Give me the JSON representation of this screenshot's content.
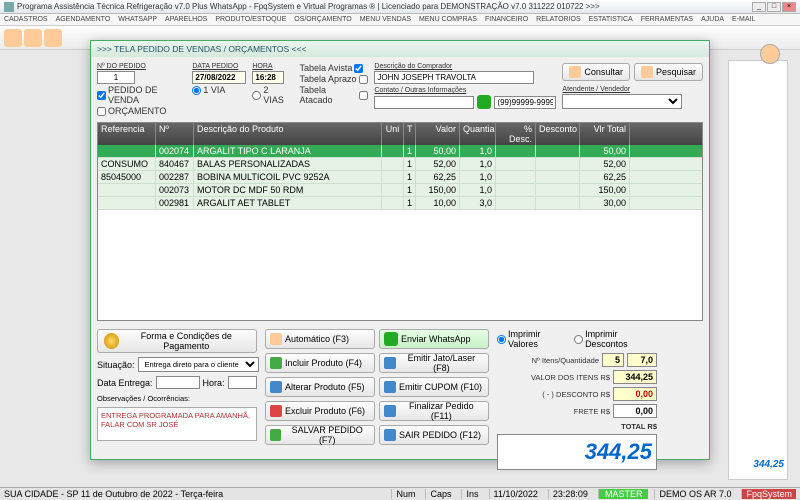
{
  "window": {
    "title": "Programa Assistência Técnica Refrigeração v7.0 Plus WhatsApp - FpqSystem e Virtual Programas ® | Licenciado para  DEMONSTRAÇÃO v7.0 311222 010722 >>>"
  },
  "menu": [
    "CADASTROS",
    "AGENDAMENTO",
    "WHATSAPP",
    "APARELHOS",
    "PRODUTO/ESTOQUE",
    "OS/ORÇAMENTO",
    "MENU VENDAS",
    "MENU COMPRAS",
    "FINANCEIRO",
    "RELATORIOS",
    "ESTATISTICA",
    "FERRAMENTAS",
    "AJUDA",
    "E-MAIL"
  ],
  "modal": {
    "title": ">>>   TELA PEDIDO DE VENDAS / ORÇAMENTOS   <<<",
    "labels": {
      "no_pedido": "Nº DO PEDIDO",
      "data_pedido": "DATA PEDIDO",
      "hora": "HORA",
      "tabela_avista": "Tabela Avista",
      "tabela_aprazo": "Tabela Aprazo",
      "tabela_atacado": "Tabela Atacado",
      "desc_comprador": "Descrição do Comprador",
      "contato": "Contato / Outras Informações",
      "atendente": "Atendente / Vendedor",
      "pedido_venda": "PEDIDO DE VENDA",
      "orcamento": "ORÇAMENTO",
      "vias1": "1 VIA",
      "vias2": "2 VIAS"
    },
    "values": {
      "no_pedido": "1",
      "data_pedido": "27/08/2022",
      "hora": "16:28",
      "comprador": "JOHN JOSEPH TRAVOLTA",
      "fone": "(99)99999-9999"
    },
    "btns": {
      "consultar": "Consultar",
      "pesquisar": "Pesquisar"
    },
    "grid": {
      "head": [
        "Referencia",
        "Nº",
        "Descrição do Produto",
        "Uni",
        "T",
        "Valor",
        "Quantia",
        "% Desc.",
        "Desconto",
        "Vlr Total"
      ],
      "rows": [
        {
          "ref": "",
          "no": "002074",
          "desc": "ARGALIT TIPO C LARANJA",
          "uni": "",
          "t": "1",
          "val": "50,00",
          "qt": "1,0",
          "pd": "",
          "dc": "",
          "tot": "50,00",
          "sel": true
        },
        {
          "ref": "CONSUMO",
          "no": "840467",
          "desc": "BALAS PERSONALIZADAS",
          "uni": "",
          "t": "1",
          "val": "52,00",
          "qt": "1,0",
          "pd": "",
          "dc": "",
          "tot": "52,00"
        },
        {
          "ref": "85045000",
          "no": "002287",
          "desc": "BOBINA MULTICOIL PVC 9252A",
          "uni": "",
          "t": "1",
          "val": "62,25",
          "qt": "1,0",
          "pd": "",
          "dc": "",
          "tot": "62,25"
        },
        {
          "ref": "",
          "no": "002073",
          "desc": "MOTOR DC MDF 50 RDM",
          "uni": "",
          "t": "1",
          "val": "150,00",
          "qt": "1,0",
          "pd": "",
          "dc": "",
          "tot": "150,00"
        },
        {
          "ref": "",
          "no": "002981",
          "desc": "ARGALIT AET TABLET",
          "uni": "",
          "t": "1",
          "val": "10,00",
          "qt": "3,0",
          "pd": "",
          "dc": "",
          "tot": "30,00"
        }
      ]
    },
    "pay_btn": "Forma e Condições de Pagamento",
    "situacao_lbl": "Situação:",
    "situacao": "Entrega direto para o cliente",
    "data_entrega_lbl": "Data Entrega:",
    "hora_lbl": "Hora:",
    "obs_lbl": "Observações / Ocorrências:",
    "obs": "ENTREGA PROGRAMADA PARA AMANHÃ, FALAR COM SR JOSÉ",
    "actions": {
      "automatico": "Automático   (F3)",
      "incluir": "Incluir Produto  (F4)",
      "alterar": "Alterar Produto   (F5)",
      "excluir": "Excluir Produto   (F6)",
      "salvar": "SALVAR PEDIDO (F7)",
      "whatsapp": "Enviar WhatsApp",
      "jato": "Emitir Jato/Laser (F8)",
      "cupom": "Emitir CUPOM   (F10)",
      "finalizar": "Finalizar Pedido  (F11)",
      "sair": "SAIR  PEDIDO  (F12)"
    },
    "summary": {
      "radio1": "Imprimir Valores",
      "radio2": "Imprimir Descontos",
      "itens_lbl": "Nº Itens/Quantidade",
      "itens_n": "5",
      "itens_q": "7,0",
      "valor_lbl": "VALOR DOS ITENS  R$",
      "valor": "344,25",
      "desc_lbl": "( - ) DESCONTO R$",
      "desc": "0,00",
      "frete_lbl": "FRETE            R$",
      "frete": "0,00",
      "total_lbl": "TOTAL R$",
      "total": "344,25"
    }
  },
  "bg_total": "344,25",
  "status": {
    "left": "SUA CIDADE - SP 11 de Outubro de 2022 - Terça-feira",
    "num": "Num",
    "caps": "Caps",
    "ins": "Ins",
    "date": "11/10/2022",
    "time": "23:28:09",
    "master": "MASTER",
    "demo": "DEMO OS AR 7.0",
    "brand": "FpqSystem"
  }
}
